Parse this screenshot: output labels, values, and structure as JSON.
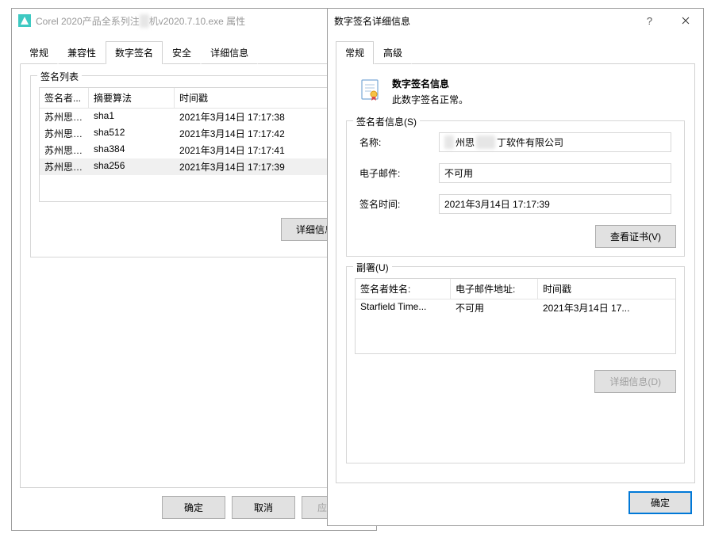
{
  "colors": {
    "accent": "#0078d7"
  },
  "win1": {
    "title_prefix": "Corel 2020产品全系列注",
    "title_suffix": "机v2020.7.10.exe 属性",
    "tabs": [
      "常规",
      "兼容性",
      "数字签名",
      "安全",
      "详细信息"
    ],
    "active_tab": 2,
    "siglist_title": "签名列表",
    "columns": [
      "签名者...",
      "摘要算法",
      "时间戳"
    ],
    "rows": [
      {
        "signer": "苏州思杰...",
        "algo": "sha1",
        "ts": "2021年3月14日 17:17:38"
      },
      {
        "signer": "苏州思杰...",
        "algo": "sha512",
        "ts": "2021年3月14日 17:17:42"
      },
      {
        "signer": "苏州思杰...",
        "algo": "sha384",
        "ts": "2021年3月14日 17:17:41"
      },
      {
        "signer": "苏州思杰...",
        "algo": "sha256",
        "ts": "2021年3月14日 17:17:39"
      }
    ],
    "selected_row": 3,
    "btn_details": "详细信息",
    "btn_ok": "确定",
    "btn_cancel": "取消",
    "btn_apply": "应用(A)"
  },
  "win2": {
    "title": "数字签名详细信息",
    "tabs": [
      "常规",
      "高级"
    ],
    "active_tab": 0,
    "sig_info_title": "数字签名信息",
    "sig_info_status": "此数字签名正常。",
    "signer_group": "签名者信息(S)",
    "label_name": "名称:",
    "label_email": "电子邮件:",
    "label_time": "签名时间:",
    "value_name_prefix": "苏",
    "value_name_mid1": "州思",
    "value_name_mid2": "杰马",
    "value_name_suffix": "丁软件有限公司",
    "value_email": "不可用",
    "value_time": "2021年3月14日 17:17:39",
    "btn_viewcert": "查看证书(V)",
    "countersig_group": "副署(U)",
    "cs_columns": [
      "签名者姓名:",
      "电子邮件地址:",
      "时间戳"
    ],
    "cs_row": {
      "signer": "Starfield Time...",
      "email": "不可用",
      "ts": "2021年3月14日 17..."
    },
    "btn_details": "详细信息(D)",
    "btn_ok": "确定"
  }
}
